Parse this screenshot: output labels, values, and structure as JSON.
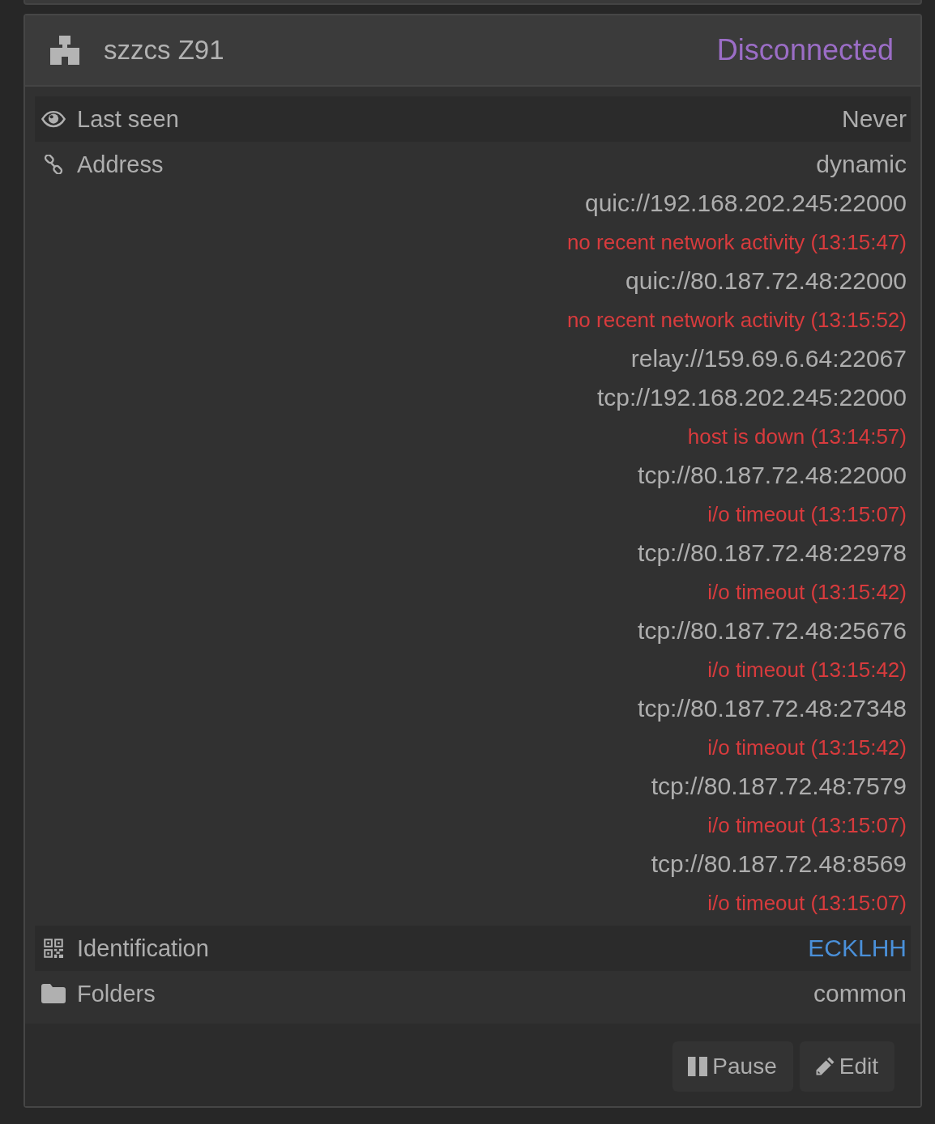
{
  "header": {
    "device_name": "szzcs Z91",
    "status": "Disconnected"
  },
  "rows": [
    {
      "kind": "last_seen",
      "label": "Last seen",
      "value": "Never"
    },
    {
      "kind": "address",
      "label": "Address",
      "lines": [
        {
          "kind": "text",
          "text": "dynamic"
        },
        {
          "kind": "text",
          "text": "quic://192.168.202.245:22000"
        },
        {
          "kind": "error",
          "text": "no recent network activity (13:15:47)"
        },
        {
          "kind": "text",
          "text": "quic://80.187.72.48:22000"
        },
        {
          "kind": "error",
          "text": "no recent network activity (13:15:52)"
        },
        {
          "kind": "text",
          "text": "relay://159.69.6.64:22067"
        },
        {
          "kind": "text",
          "text": "tcp://192.168.202.245:22000"
        },
        {
          "kind": "error",
          "text": "host is down (13:14:57)"
        },
        {
          "kind": "text",
          "text": "tcp://80.187.72.48:22000"
        },
        {
          "kind": "error",
          "text": "i/o timeout (13:15:07)"
        },
        {
          "kind": "text",
          "text": "tcp://80.187.72.48:22978"
        },
        {
          "kind": "error",
          "text": "i/o timeout (13:15:42)"
        },
        {
          "kind": "text",
          "text": "tcp://80.187.72.48:25676"
        },
        {
          "kind": "error",
          "text": "i/o timeout (13:15:42)"
        },
        {
          "kind": "text",
          "text": "tcp://80.187.72.48:27348"
        },
        {
          "kind": "error",
          "text": "i/o timeout (13:15:42)"
        },
        {
          "kind": "text",
          "text": "tcp://80.187.72.48:7579"
        },
        {
          "kind": "error",
          "text": "i/o timeout (13:15:07)"
        },
        {
          "kind": "text",
          "text": "tcp://80.187.72.48:8569"
        },
        {
          "kind": "error",
          "text": "i/o timeout (13:15:07)"
        }
      ]
    },
    {
      "kind": "identification",
      "label": "Identification",
      "value": "ECKLHH"
    },
    {
      "kind": "folders",
      "label": "Folders",
      "value": "common"
    }
  ],
  "buttons": [
    {
      "kind": "pause",
      "label": "Pause"
    },
    {
      "kind": "edit",
      "label": "Edit"
    }
  ]
}
